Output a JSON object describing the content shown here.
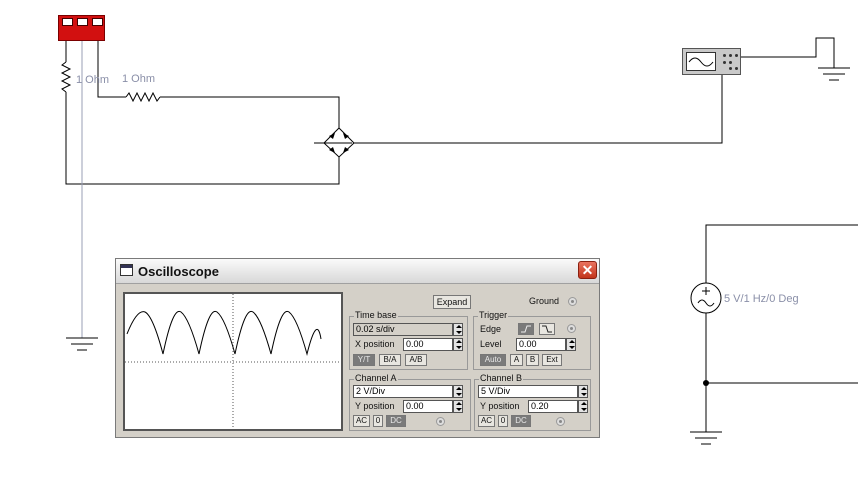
{
  "schematic": {
    "resistor1_label": "1 Ohm",
    "resistor2_label": "1 Ohm",
    "source_label": "5 V/1 Hz/0 Deg"
  },
  "oscilloscope": {
    "title": "Oscilloscope",
    "close_symbol": "✕",
    "expand_label": "Expand",
    "ground_label": "Ground",
    "time_base": {
      "group_label": "Time base",
      "value": "0.02 s/div",
      "x_position_label": "X position",
      "x_position_value": "0.00",
      "modes": [
        "Y/T",
        "B/A",
        "A/B"
      ]
    },
    "trigger": {
      "group_label": "Trigger",
      "edge_label": "Edge",
      "level_label": "Level",
      "level_value": "0.00",
      "sources": [
        "Auto",
        "A",
        "B",
        "Ext"
      ]
    },
    "channel_a": {
      "group_label": "Channel A",
      "scale": "2  V/Div",
      "y_position_label": "Y position",
      "y_position_value": "0.00",
      "coupling": [
        "AC",
        "0",
        "DC"
      ]
    },
    "channel_b": {
      "group_label": "Channel B",
      "scale": "5  V/Div",
      "y_position_label": "Y position",
      "y_position_value": "0.20",
      "coupling": [
        "AC",
        "0",
        "DC"
      ]
    }
  }
}
